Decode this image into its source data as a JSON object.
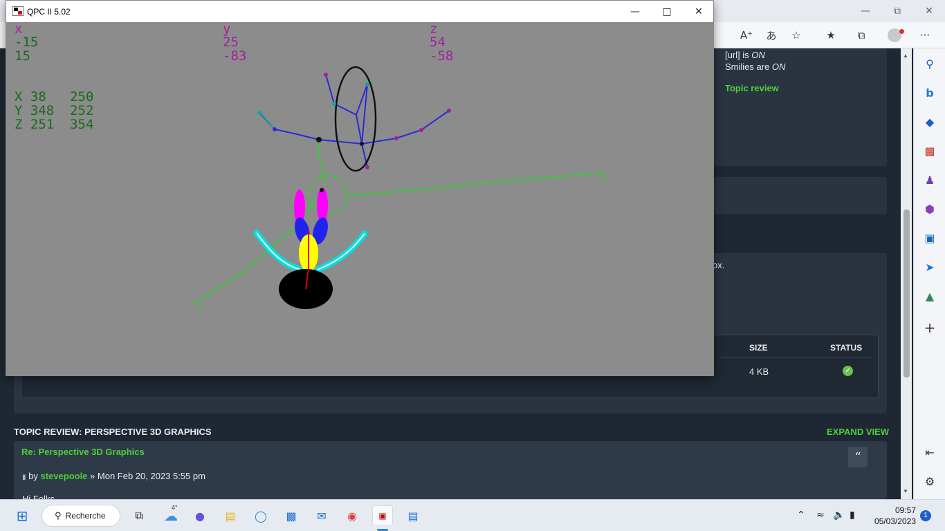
{
  "browser": {
    "bbcode_url": "[url] is",
    "bbcode_url_state": "ON",
    "smilies": "Smilies are",
    "smilies_state": "ON",
    "topic_review_link": "Topic review",
    "partial_text": "ox.",
    "attachments": {
      "col_size": "SIZE",
      "col_status": "STATUS",
      "row_size": "4 KB",
      "row_status_icon": "check-circle-icon"
    },
    "review_title": "TOPIC REVIEW: PERSPECTIVE 3D GRAPHICS",
    "expand_view": "EXPAND VIEW",
    "post": {
      "title": "Re: Perspective 3D Graphics",
      "by": "by",
      "author": "stevepoole",
      "date": "» Mon Feb 20, 2023 5:55 pm",
      "peek": "Hi Folks"
    },
    "toolbar_icons": [
      "read-aloud-icon",
      "translate-icon",
      "add-favorite-icon",
      "favorites-icon",
      "collections-icon",
      "profile-icon",
      "more-icon"
    ],
    "sidebar_icons": [
      "search-icon",
      "bing-icon",
      "shopping-icon",
      "tools-icon",
      "games-icon",
      "office-icon",
      "outlook-icon",
      "send-icon",
      "tree-icon",
      "add-icon"
    ],
    "accent_green": "#4cd137"
  },
  "qpc": {
    "title": "QPC II 5.02",
    "labels": {
      "x_head": "x",
      "x1": "-15",
      "x2": "15",
      "y_head": "y",
      "y1": "25",
      "y2": "-83",
      "z_head": "z",
      "z1": "54",
      "z2": "-58",
      "row_x": "X 38   250",
      "row_y": "Y 348  252",
      "row_z": "Z 251  354"
    }
  },
  "taskbar": {
    "search": "Recherche",
    "weather_temp": "4°",
    "time": "09:57",
    "date": "05/03/2023",
    "notifications": "1"
  }
}
